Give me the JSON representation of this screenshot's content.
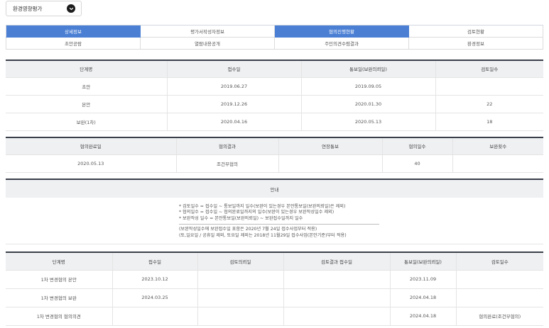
{
  "select": {
    "value": "환경영향평가"
  },
  "tabs": {
    "row1": [
      {
        "label": "상세정보",
        "active": true
      },
      {
        "label": "평가서작성자정보",
        "active": false
      },
      {
        "label": "협의진행현황",
        "active": true
      },
      {
        "label": "검토현황",
        "active": false
      }
    ],
    "row2": [
      {
        "label": "초안공람",
        "active": false
      },
      {
        "label": "열람내용공개",
        "active": false
      },
      {
        "label": "주민의견수렴결과",
        "active": false
      },
      {
        "label": "환경정보",
        "active": false
      }
    ]
  },
  "stage_table": {
    "headers": [
      "단계명",
      "접수일",
      "통보일(보완의뢰일)",
      "검토일수"
    ],
    "rows": [
      [
        "초안",
        "2019.06.27",
        "2019.09.05",
        ""
      ],
      [
        "본안",
        "2019.12.26",
        "2020.01.30",
        "22"
      ],
      [
        "보완(1차)",
        "2020.04.16",
        "2020.05.13",
        "18"
      ]
    ]
  },
  "result_table": {
    "headers": [
      "협의완료일",
      "협의결과",
      "연장통보",
      "협의일수",
      "보완횟수"
    ],
    "rows": [
      [
        "2020.05.13",
        "조건부협의",
        "",
        "40",
        ""
      ]
    ]
  },
  "notice": {
    "title": "안내",
    "lines": [
      "* 검토일수 = 접수일 ~ 통보일까지 일수(보완이 있는경우 본안통보일(보완의뢰일)은 제외)",
      "* 협의일수 = 접수일 ~ 협의완료일까지의 일수(보완이 있는경우 보완작성일수 제외)",
      "* 보완작성 일수 = 본안통보일(보완의뢰일) ~ 보완접수일까지 일수"
    ],
    "footnotes": [
      "(보완작성일수에 보완접수일 포함은 2020년 7월 24일 접수사업부터 적용)",
      "(토,일요일 / 공휴일 제외, 토요일 제외는 2018년 11월29일 접수사업(본안기준)부터 적용)"
    ]
  },
  "change_table": {
    "headers": [
      "단계명",
      "접수일",
      "검토의뢰일",
      "검토결과 접수일",
      "통보일(보완의뢰일)",
      "검토일수"
    ],
    "rows": [
      [
        "1차 변경협의 본안",
        "2023.10.12",
        "",
        "",
        "2023.11.09",
        ""
      ],
      [
        "1차 변경협의 보완",
        "2024.03.25",
        "",
        "",
        "2024.04.18",
        ""
      ],
      [
        "1차 변경협의 협의의견",
        "",
        "",
        "",
        "2024.04.18",
        "협의완료(조건부협의)"
      ]
    ]
  }
}
